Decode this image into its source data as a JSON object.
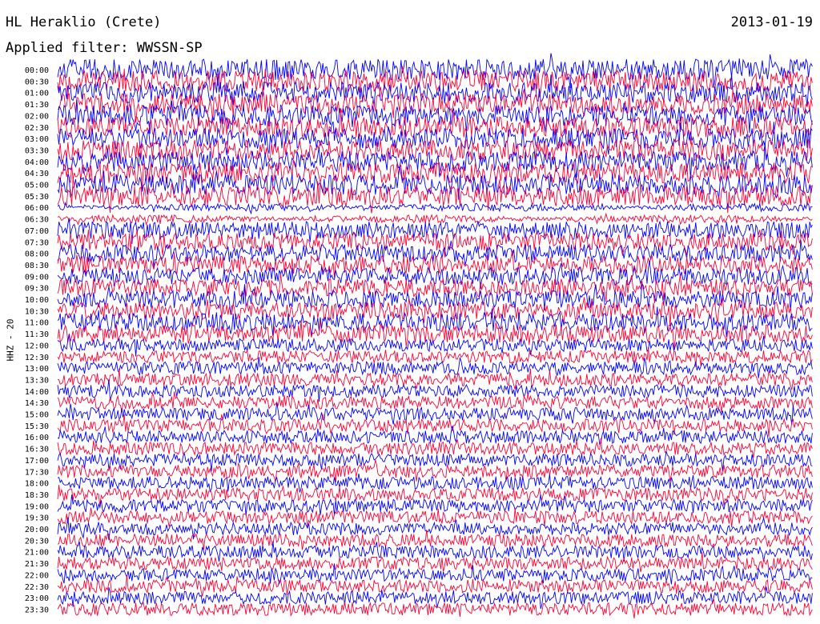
{
  "header": {
    "station": "HL Heraklio (Crete)",
    "date": "2013-01-19",
    "filter": "Applied filter: WWSSN-SP"
  },
  "chart_data": {
    "type": "line",
    "title": "HL Heraklio (Crete)",
    "date": "2013-01-19",
    "filter": "Applied filter: WWSSN-SP",
    "ylabel": "HHZ - 20",
    "row_labels": [
      "00:00",
      "00:30",
      "01:00",
      "01:30",
      "02:00",
      "02:30",
      "03:00",
      "03:30",
      "04:00",
      "04:30",
      "05:00",
      "05:30",
      "06:00",
      "06:30",
      "07:00",
      "07:30",
      "08:00",
      "08:30",
      "09:00",
      "09:30",
      "10:00",
      "10:30",
      "11:00",
      "11:30",
      "12:00",
      "12:30",
      "13:00",
      "13:30",
      "14:00",
      "14:30",
      "15:00",
      "15:30",
      "16:00",
      "16:30",
      "17:00",
      "17:30",
      "18:00",
      "18:30",
      "19:00",
      "19:30",
      "20:00",
      "20:30",
      "21:00",
      "21:30",
      "22:00",
      "22:30",
      "23:00",
      "23:30"
    ],
    "series_colors": [
      "#0000ff",
      "#ff0033"
    ],
    "grid": false,
    "legend": "none"
  }
}
